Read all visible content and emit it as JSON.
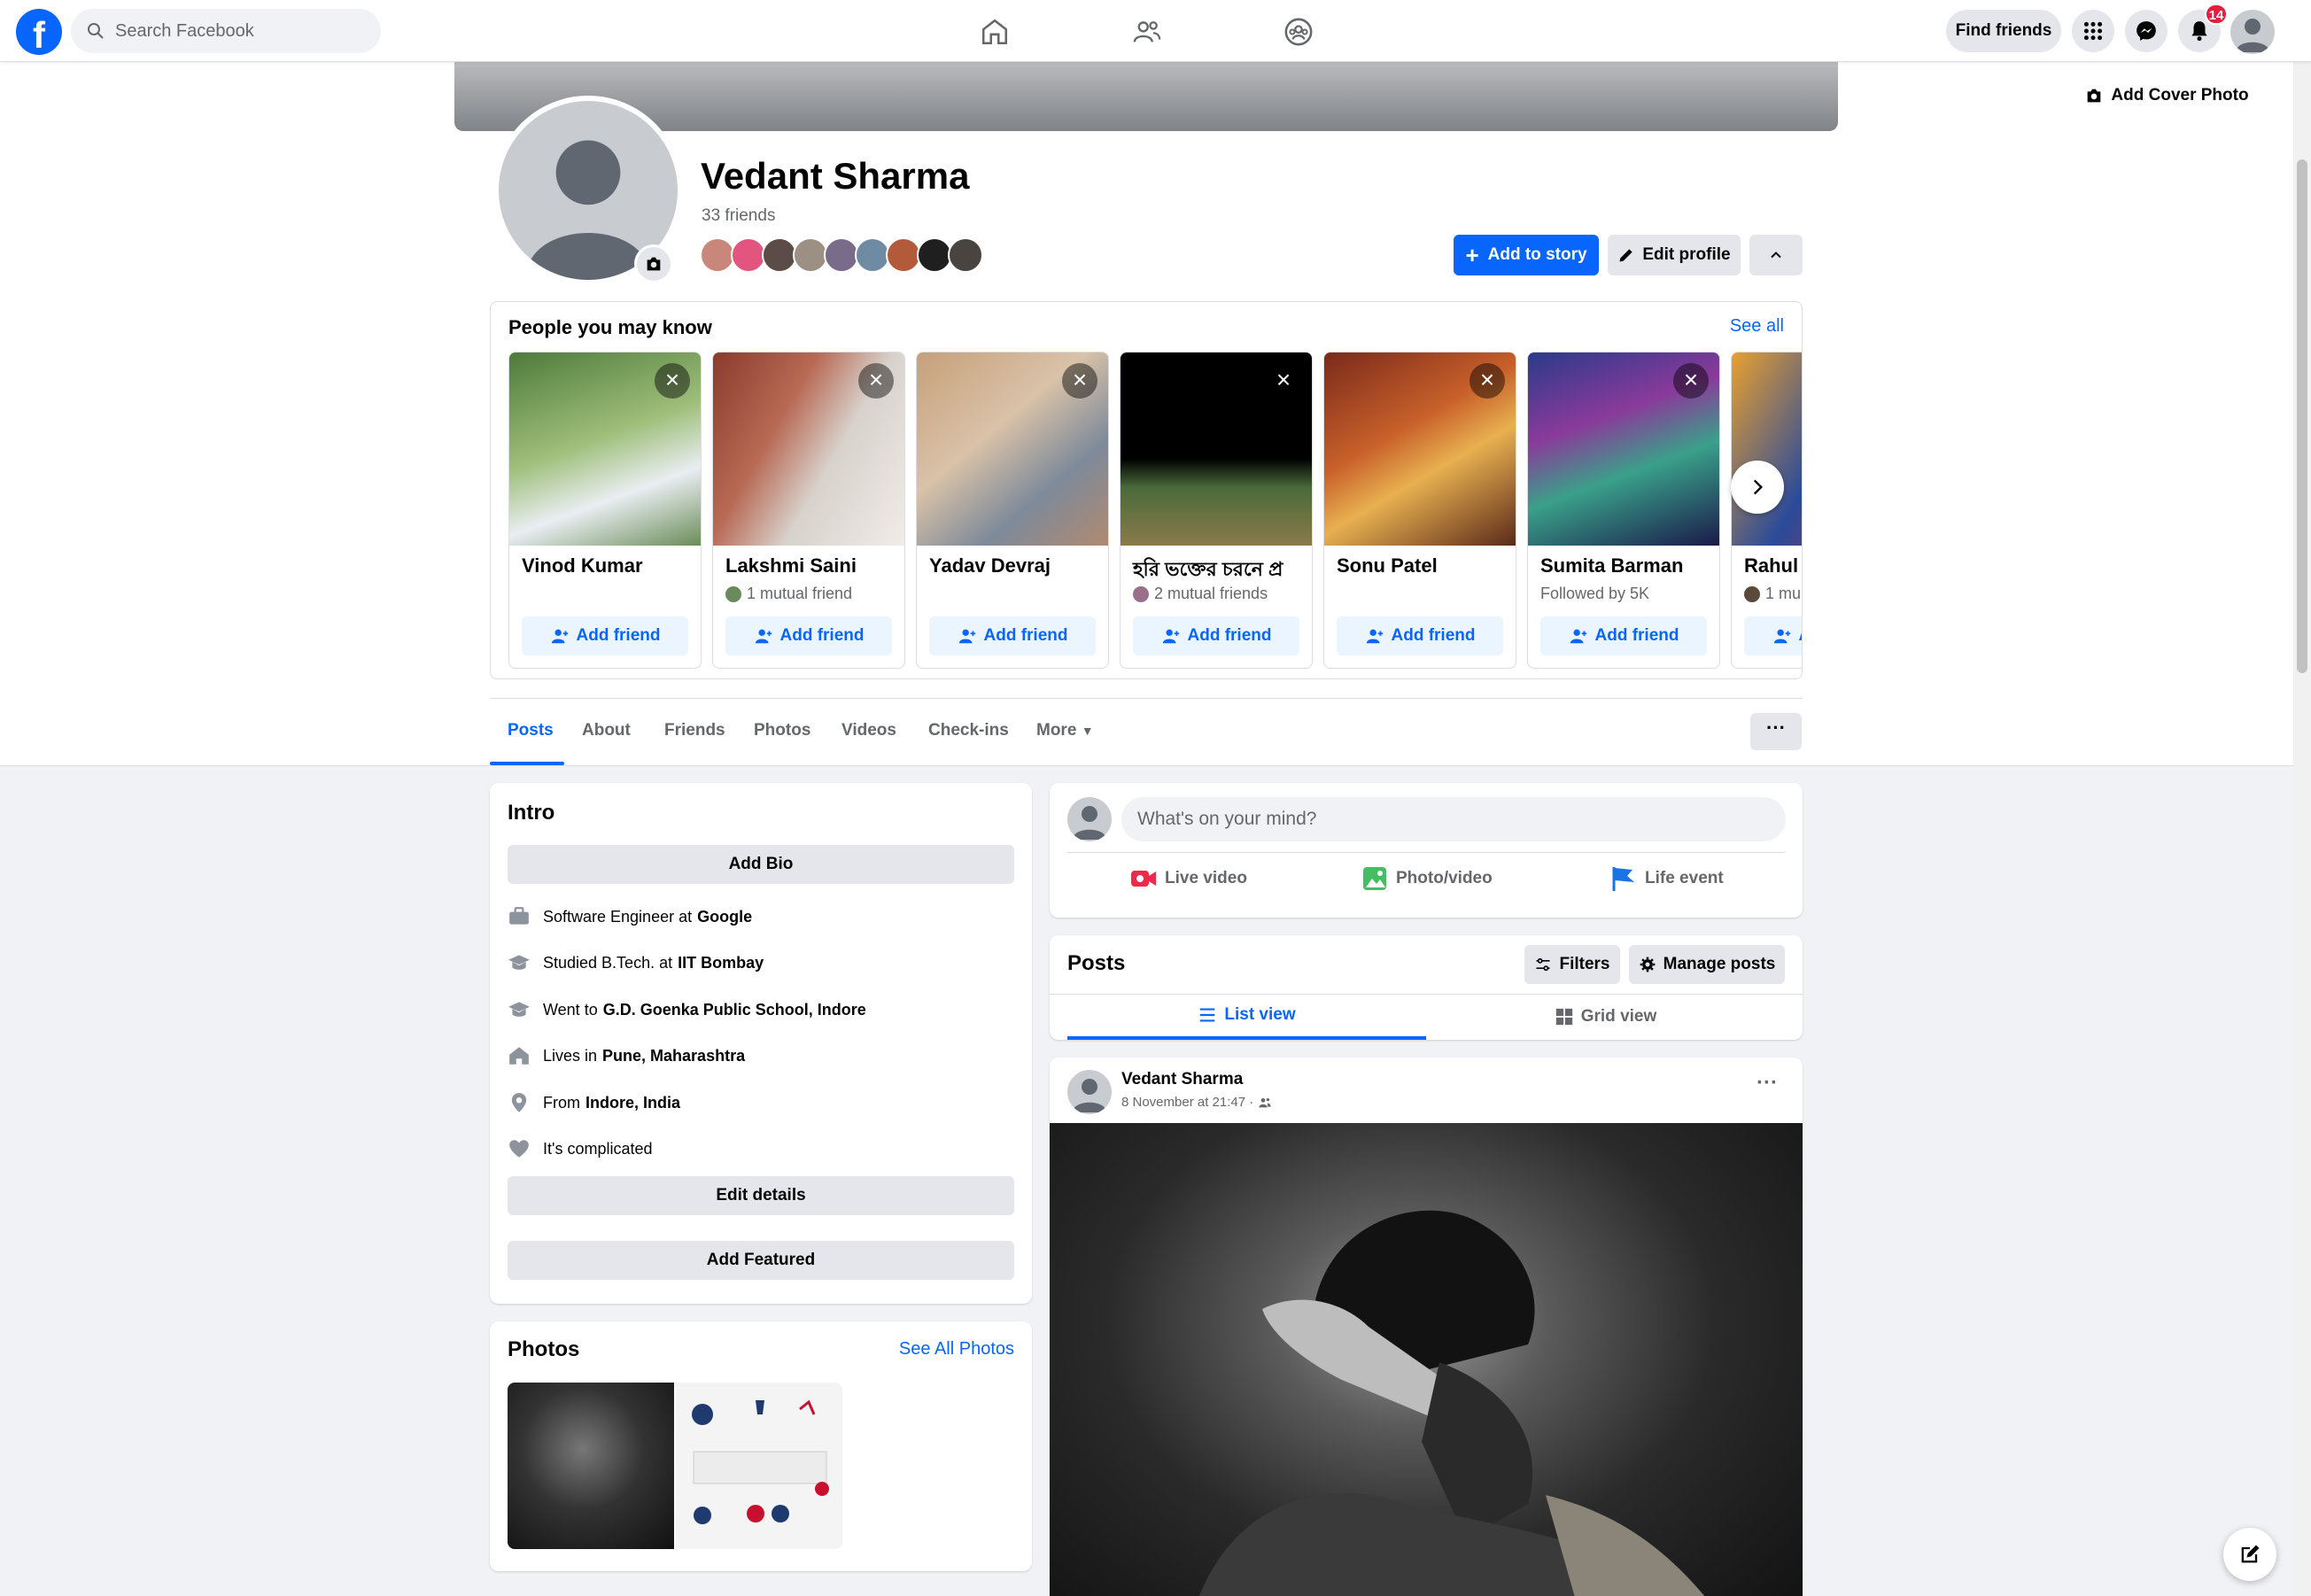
{
  "nav": {
    "search_placeholder": "Search Facebook",
    "find_friends": "Find friends",
    "notifications_count": "14",
    "accent": "#0866ff",
    "icons": [
      "home-icon",
      "friends-icon",
      "groups-icon",
      "menu-grid-icon",
      "messenger-icon",
      "bell-icon"
    ]
  },
  "profile": {
    "add_cover": "Add Cover Photo",
    "name": "Vedant Sharma",
    "friends_count": "33 friends",
    "add_story": "Add to story",
    "edit_profile": "Edit profile"
  },
  "pymk": {
    "title": "People you may know",
    "see_all": "See all",
    "add_label": "Add friend",
    "people": [
      {
        "name": "Vinod Kumar",
        "mutual": ""
      },
      {
        "name": "Lakshmi Saini",
        "mutual": "1 mutual friend"
      },
      {
        "name": "Yadav Devraj",
        "mutual": ""
      },
      {
        "name": "হরি ভক্তের চরনে প্র",
        "mutual": "2 mutual friends"
      },
      {
        "name": "Sonu Patel",
        "mutual": ""
      },
      {
        "name": "Sumita Barman",
        "mutual": "Followed by 5K"
      },
      {
        "name": "Rahul I",
        "mutual": "1 mu"
      }
    ]
  },
  "tabs": [
    "Posts",
    "About",
    "Friends",
    "Photos",
    "Videos",
    "Check-ins",
    "More"
  ],
  "intro": {
    "title": "Intro",
    "add_bio": "Add Bio",
    "work_prefix": "Software Engineer at",
    "work": "Google",
    "edu_prefix": "Studied B.Tech. at",
    "edu": "IIT Bombay",
    "school_prefix": "Went to",
    "school": "G.D. Goenka Public School, Indore",
    "lives_prefix": "Lives in",
    "lives": "Pune, Maharashtra",
    "from_prefix": "From",
    "from": "Indore, India",
    "relationship": "It's complicated",
    "edit_details": "Edit details",
    "add_featured": "Add Featured"
  },
  "photos": {
    "title": "Photos",
    "see_all": "See All Photos"
  },
  "composer": {
    "placeholder": "What's on your mind?",
    "live": "Live video",
    "photo": "Photo/video",
    "life": "Life event"
  },
  "posts_header": {
    "title": "Posts",
    "filters": "Filters",
    "manage": "Manage posts",
    "list_view": "List view",
    "grid_view": "Grid view"
  },
  "post": {
    "author": "Vedant Sharma",
    "time": "8 November at 21:47 ·"
  }
}
